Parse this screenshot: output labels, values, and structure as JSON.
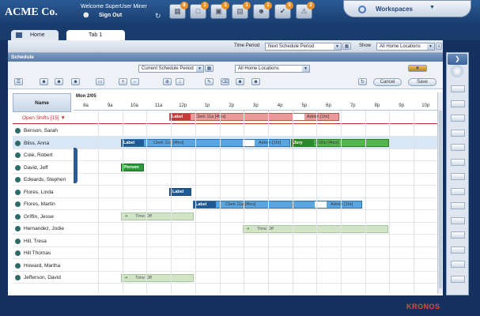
{
  "header": {
    "logo_text": "ACME Co.",
    "welcome": "Welcome SuperUser Miner",
    "sign_out": "Sign Out",
    "toolbar_badges": [
      "8",
      "1",
      "1",
      "1",
      "1",
      "5",
      "2"
    ],
    "workspaces_label": "Workspaces"
  },
  "tabs": [
    {
      "label": "Home"
    },
    {
      "label": "Tab 1"
    }
  ],
  "filters": {
    "time_period_label": "Time Period",
    "time_period_value": "Next Schedule Period",
    "show_label": "Show",
    "show_value": "All Home Locations"
  },
  "schedule": {
    "title": "Schedule",
    "period_select": "Current Schedule Period",
    "location_select": "All Home Locations",
    "cancel": "Cancel",
    "save": "Save",
    "name_col": "Name",
    "date": "Mon 2/05",
    "hours": [
      "8a",
      "9a",
      "10a",
      "11a",
      "12p",
      "1p",
      "2p",
      "3p",
      "4p",
      "5p",
      "6p",
      "7p",
      "8p",
      "9p",
      "10p"
    ],
    "open_shifts": "Open Shifts [15]",
    "employees": [
      "Benson, Sarah",
      "Bliss, Anna",
      "Cole, Robert",
      "David, Jeff",
      "Edwards, Stephen",
      "Flores, Linda",
      "Flores, Martin",
      "Griffin, Jesse",
      "Hernandez, Jodie",
      "Hill, Tresa",
      "Hill Thomas",
      "Howard, Martha",
      "Jefferson, David"
    ],
    "shift_text": {
      "label": "Label",
      "clerk": "Clerk 11a [4hrs]",
      "admin": "Admin [1hr]",
      "jury": "Jury",
      "jury_time": "2:00p [4hrs]",
      "person": "Person",
      "time_off": "Time Off"
    }
  },
  "footer": {
    "brand": "KRONOS"
  },
  "colors": {
    "accent": "#1e4a84",
    "open_shift": "#e98a8a",
    "clerk_blue": "#5aa6e0",
    "jury_green": "#3aa646",
    "time_off": "#d2e4c6"
  }
}
